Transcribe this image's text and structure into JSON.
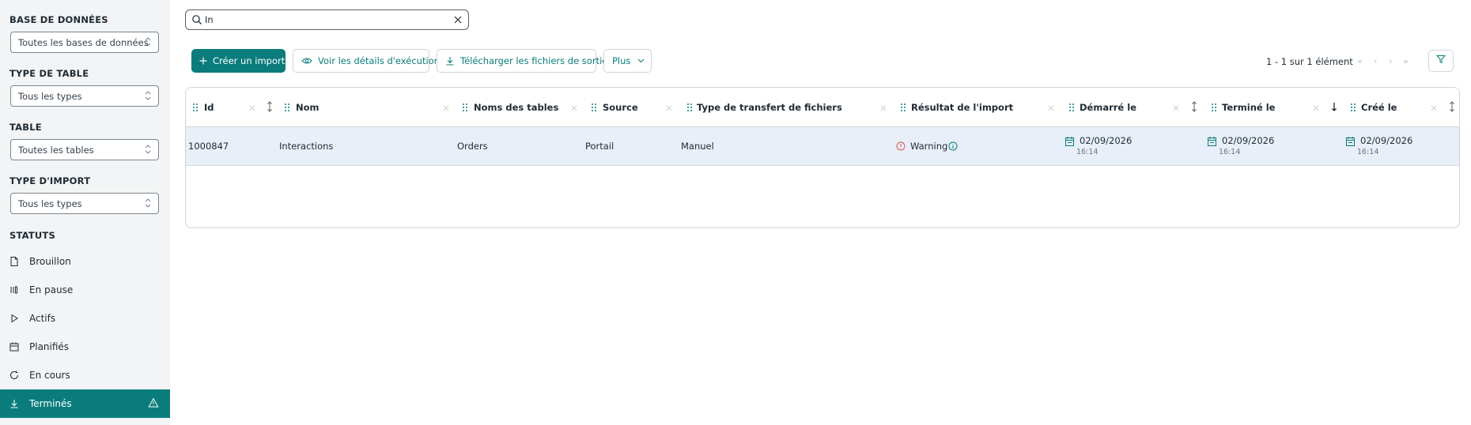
{
  "sidebar": {
    "db_title": "BASE DE DONNÉES",
    "db_value": "Toutes les bases de données",
    "tabletype_title": "TYPE DE TABLE",
    "tabletype_value": "Tous les types",
    "table_title": "TABLE",
    "table_value": "Toutes les tables",
    "importtype_title": "TYPE D'IMPORT",
    "importtype_value": "Tous les types",
    "statuses_title": "STATUTS",
    "statuses": [
      {
        "label": "Brouillon",
        "icon": "file-icon"
      },
      {
        "label": "En pause",
        "icon": "pause-icon"
      },
      {
        "label": "Actifs",
        "icon": "play-icon"
      },
      {
        "label": "Planifiés",
        "icon": "calendar-icon"
      },
      {
        "label": "En cours",
        "icon": "refresh-icon"
      },
      {
        "label": "Terminés",
        "icon": "download-icon",
        "active": true
      }
    ]
  },
  "search": {
    "value": "In"
  },
  "toolbar": {
    "create_label": "Créer un import",
    "details_label": "Voir les détails d'exécution",
    "download_label": "Télécharger les fichiers de sortie",
    "more_label": "Plus"
  },
  "pagination": {
    "text": "1 - 1 sur 1 élément"
  },
  "table": {
    "columns": [
      "Id",
      "Nom",
      "Noms des tables",
      "Source",
      "Type de transfert de fichiers",
      "Résultat de l'import",
      "Démarré le",
      "Terminé le",
      "Créé le"
    ],
    "rows": [
      {
        "id": "1000847",
        "nom": "Interactions",
        "tables": "Orders",
        "source": "Portail",
        "transfert": "Manuel",
        "resultat": "Warning",
        "demarre_date": "02/09/2026",
        "demarre_time": "16:14",
        "termine_date": "02/09/2026",
        "termine_time": "16:14",
        "cree_date": "02/09/2026",
        "cree_time": "16:14"
      }
    ]
  },
  "colors": {
    "accent": "#0a7c7c",
    "row_selected": "#e8eff8",
    "warning": "#d9534f"
  }
}
